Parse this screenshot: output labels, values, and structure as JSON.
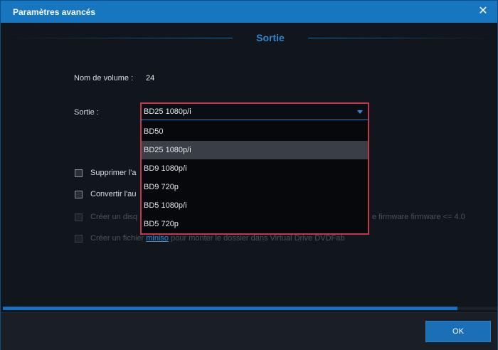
{
  "window": {
    "title": "Paramètres avancés",
    "close_icon": "close-icon"
  },
  "section": {
    "title": "Sortie"
  },
  "volume": {
    "label": "Nom de volume :",
    "value": "24"
  },
  "output": {
    "label": "Sortie :",
    "selected": "BD25 1080p/i",
    "options": [
      "BD50",
      "BD25 1080p/i",
      "BD9 1080p/i",
      "BD9 720p",
      "BD5 1080p/i",
      "BD5 720p"
    ],
    "highlighted_index": 1
  },
  "checkboxes": [
    {
      "label": "Supprimer l'a",
      "checked": false,
      "enabled": true
    },
    {
      "label": "Convertir l'au",
      "checked": false,
      "enabled": true
    },
    {
      "label_start": "Créer un disq",
      "label_end": "e firmware firmware <= 4.0",
      "checked": false,
      "enabled": false
    },
    {
      "label_prefix": "Créer un fichier",
      "label_link": "miniso",
      "label_suffix": "pour monter le dossier dans Virtual Drive DVDFab",
      "checked": false,
      "enabled": false
    }
  ],
  "progress": {
    "fraction": 0.92
  },
  "footer": {
    "ok_label": "OK"
  },
  "colors": {
    "accent": "#1676bf",
    "highlight_border": "#c3394b",
    "link": "#2c8ddc"
  }
}
